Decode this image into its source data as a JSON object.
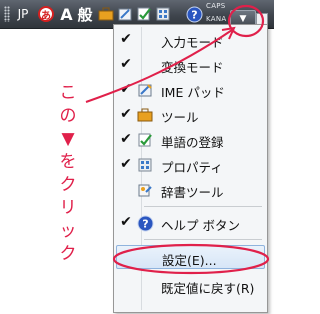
{
  "langbar": {
    "lang_label": "JP",
    "ime_icon_glyph": "あ",
    "input_mode_label": "A",
    "mode_label": "般",
    "caps_label": "CAPS",
    "kana_label": "KANA",
    "icons": [
      "toolbox-icon",
      "pencil-icon",
      "help-icon"
    ]
  },
  "menu": {
    "items": [
      {
        "label": "入力モード",
        "checked": true,
        "icon": "none"
      },
      {
        "label": "変換モード",
        "checked": true,
        "icon": "none"
      },
      {
        "label": "IME パッド",
        "checked": true,
        "icon": "ime-pad-icon"
      },
      {
        "label": "ツール",
        "checked": true,
        "icon": "toolbox-icon"
      },
      {
        "label": "単語の登録",
        "checked": true,
        "icon": "register-word-icon"
      },
      {
        "label": "プロパティ",
        "checked": true,
        "icon": "properties-icon"
      },
      {
        "label": "辞書ツール",
        "checked": false,
        "icon": "dictionary-tool-icon"
      },
      {
        "label": "ヘルプ ボタン",
        "checked": true,
        "icon": "help-icon"
      },
      {
        "label": "設定(E)...",
        "checked": false,
        "icon": "none"
      },
      {
        "label": "既定値に戻す(R)",
        "checked": false,
        "icon": "none"
      }
    ]
  },
  "annotation": {
    "text": "この▼をクリック",
    "color": "#e0204a"
  }
}
